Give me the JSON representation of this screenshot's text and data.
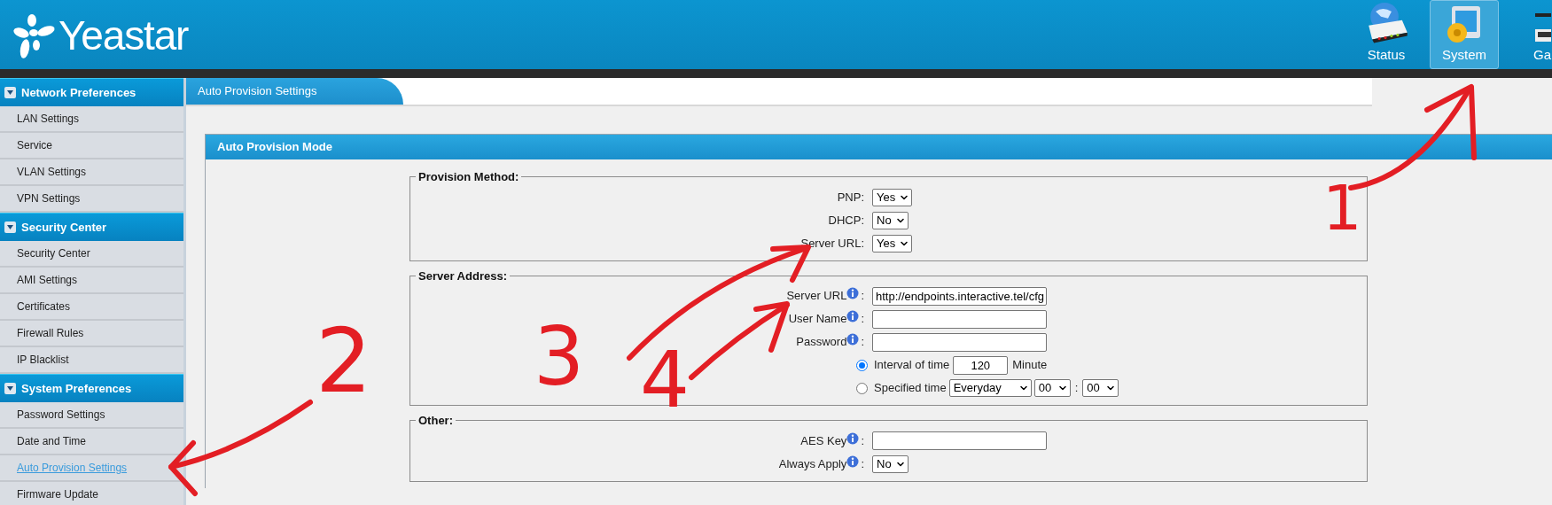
{
  "header": {
    "logo": "Yeastar",
    "nav": [
      {
        "kind": "status",
        "label": "Status",
        "selected": false
      },
      {
        "kind": "system",
        "label": "System",
        "selected": true
      },
      {
        "kind": "gateway",
        "label": "Ga",
        "selected": false
      }
    ]
  },
  "sidebar": {
    "sections": [
      {
        "title": "Network Preferences",
        "expanded": true,
        "items": [
          {
            "label": "LAN Settings",
            "selected": false
          },
          {
            "label": "Service",
            "selected": false
          },
          {
            "label": "VLAN Settings",
            "selected": false
          },
          {
            "label": "VPN Settings",
            "selected": false
          }
        ]
      },
      {
        "title": "Security Center",
        "expanded": true,
        "items": [
          {
            "label": "Security Center",
            "selected": false
          },
          {
            "label": "AMI Settings",
            "selected": false
          },
          {
            "label": "Certificates",
            "selected": false
          },
          {
            "label": "Firewall Rules",
            "selected": false
          },
          {
            "label": "IP Blacklist",
            "selected": false
          }
        ]
      },
      {
        "title": "System Preferences",
        "expanded": true,
        "items": [
          {
            "label": "Password Settings",
            "selected": false
          },
          {
            "label": "Date and Time",
            "selected": false
          },
          {
            "label": "Auto Provision Settings",
            "selected": true
          },
          {
            "label": "Firmware Update",
            "selected": false
          }
        ]
      }
    ]
  },
  "tab": {
    "label": "Auto Provision Settings"
  },
  "panel": {
    "title": "Auto Provision Mode",
    "fieldsets": [
      {
        "legend": "Provision Method:",
        "rows": [
          {
            "kind": "select",
            "label": "PNP:",
            "value": "Yes"
          },
          {
            "kind": "select",
            "label": "DHCP:",
            "value": "No"
          },
          {
            "kind": "select",
            "label": "Server URL:",
            "value": "Yes"
          }
        ]
      },
      {
        "legend": "Server Address:",
        "rows": [
          {
            "kind": "text",
            "label": "Server URL",
            "info": true,
            "suffix": ":",
            "value": "http://endpoints.interactive.tel/cfg"
          },
          {
            "kind": "text",
            "label": "User Name",
            "info": true,
            "suffix": ":"
          },
          {
            "kind": "text",
            "label": "Password",
            "info": true,
            "suffix": ":"
          },
          {
            "kind": "radio",
            "label": "Interval of time",
            "selected": true,
            "value": "120",
            "unit": "Minute"
          },
          {
            "kind": "radio",
            "label": "Specified time",
            "selected": false,
            "selects": [
              "Everyday",
              "00",
              "00"
            ],
            "separator": ":"
          }
        ]
      },
      {
        "legend": "Other:",
        "rows": [
          {
            "kind": "text",
            "label": "AES Key",
            "info": true,
            "suffix": ":"
          },
          {
            "kind": "select",
            "label": "Always Apply",
            "info": true,
            "suffix": ":",
            "value": "No"
          }
        ]
      }
    ]
  },
  "annotations": [
    {
      "label": "1"
    },
    {
      "label": "2"
    },
    {
      "label": "3"
    },
    {
      "label": "4"
    }
  ]
}
